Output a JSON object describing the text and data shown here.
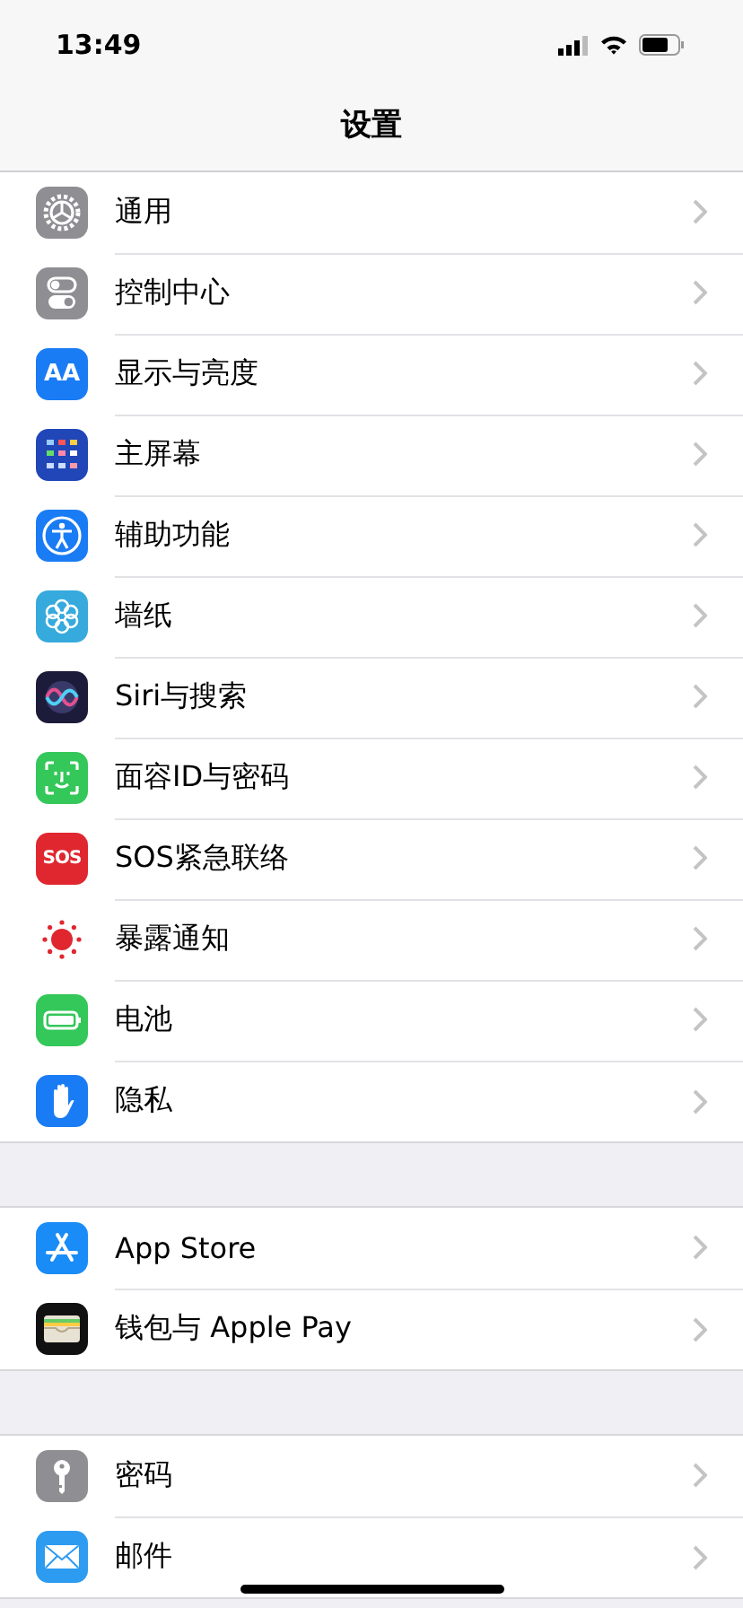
{
  "status_bar": {
    "time": "13:49"
  },
  "nav": {
    "title": "设置"
  },
  "groups": [
    {
      "items": [
        {
          "label": "通用",
          "kind": "general"
        },
        {
          "label": "控制中心",
          "kind": "control"
        },
        {
          "label": "显示与亮度",
          "kind": "display",
          "badge": "AA"
        },
        {
          "label": "主屏幕",
          "kind": "home"
        },
        {
          "label": "辅助功能",
          "kind": "accessibility"
        },
        {
          "label": "墙纸",
          "kind": "wallpaper"
        },
        {
          "label": "Siri与搜索",
          "kind": "siri"
        },
        {
          "label": "面容ID与密码",
          "kind": "faceid"
        },
        {
          "label": "SOS紧急联络",
          "kind": "sos",
          "badge": "SOS"
        },
        {
          "label": "暴露通知",
          "kind": "exposure"
        },
        {
          "label": "电池",
          "kind": "battery"
        },
        {
          "label": "隐私",
          "kind": "privacy"
        }
      ]
    },
    {
      "items": [
        {
          "label": "App Store",
          "kind": "appstore"
        },
        {
          "label": "钱包与 Apple Pay",
          "kind": "wallet"
        }
      ]
    },
    {
      "items": [
        {
          "label": "密码",
          "kind": "passwords"
        },
        {
          "label": "邮件",
          "kind": "mail"
        }
      ]
    }
  ]
}
